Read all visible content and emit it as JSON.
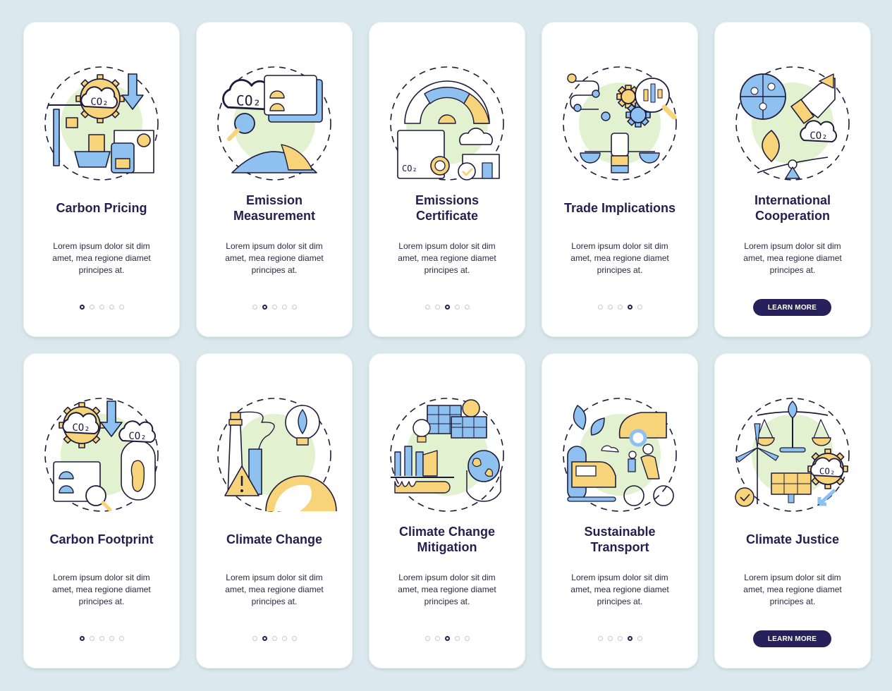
{
  "colors": {
    "background": "#dbe9ee",
    "card": "#ffffff",
    "title": "#231f4f",
    "button": "#27205a",
    "accent_yellow": "#f7d37a",
    "accent_blue": "#8fc1f0",
    "accent_green": "#e2f2d0",
    "stroke": "#1e1b3a"
  },
  "screens": [
    {
      "title": "Carbon Pricing",
      "icon": "carbon-pricing-icon",
      "description": "Lorem ipsum dolor sit dim amet, mea regione diamet principes at.",
      "page": 1,
      "total_pages": 5,
      "button": null
    },
    {
      "title": "Emission Measurement",
      "icon": "emission-measurement-icon",
      "description": "Lorem ipsum dolor sit dim amet, mea regione diamet principes at.",
      "page": 2,
      "total_pages": 5,
      "button": null
    },
    {
      "title": "Emissions Certificate",
      "icon": "emissions-certificate-icon",
      "description": "Lorem ipsum dolor sit dim amet, mea regione diamet principes at.",
      "page": 3,
      "total_pages": 5,
      "button": null
    },
    {
      "title": "Trade Implications",
      "icon": "trade-implications-icon",
      "description": "Lorem ipsum dolor sit dim amet, mea regione diamet principes at.",
      "page": 4,
      "total_pages": 5,
      "button": null
    },
    {
      "title": "International Cooperation",
      "icon": "international-cooperation-icon",
      "description": "Lorem ipsum dolor sit dim amet, mea regione diamet principes at.",
      "page": 5,
      "total_pages": 5,
      "button": "LEARN MORE"
    },
    {
      "title": "Carbon Footprint",
      "icon": "carbon-footprint-icon",
      "description": "Lorem ipsum dolor sit dim amet, mea regione diamet principes at.",
      "page": 1,
      "total_pages": 5,
      "button": null
    },
    {
      "title": "Climate Change",
      "icon": "climate-change-icon",
      "description": "Lorem ipsum dolor sit dim amet, mea regione diamet principes at.",
      "page": 2,
      "total_pages": 5,
      "button": null
    },
    {
      "title": "Climate Change Mitigation",
      "icon": "climate-change-mitigation-icon",
      "description": "Lorem ipsum dolor sit dim amet, mea regione diamet principes at.",
      "page": 3,
      "total_pages": 5,
      "button": null
    },
    {
      "title": "Sustainable Transport",
      "icon": "sustainable-transport-icon",
      "description": "Lorem ipsum dolor sit dim amet, mea regione diamet principes at.",
      "page": 4,
      "total_pages": 5,
      "button": null
    },
    {
      "title": "Climate Justice",
      "icon": "climate-justice-icon",
      "description": "Lorem ipsum dolor sit dim amet, mea regione diamet principes at.",
      "page": 5,
      "total_pages": 5,
      "button": "LEARN MORE"
    }
  ],
  "title_lines": [
    [
      "Carbon Pricing"
    ],
    [
      "Emission",
      "Measurement"
    ],
    [
      "Emissions",
      "Certificate"
    ],
    [
      "Trade Implications"
    ],
    [
      "International",
      "Cooperation"
    ],
    [
      "Carbon Footprint"
    ],
    [
      "Climate Change"
    ],
    [
      "Climate Change",
      "Mitigation"
    ],
    [
      "Sustainable",
      "Transport"
    ],
    [
      "Climate Justice"
    ]
  ],
  "description_lines": [
    "Lorem ipsum dolor sit dim",
    "amet, mea regione diamet",
    "principes at."
  ]
}
